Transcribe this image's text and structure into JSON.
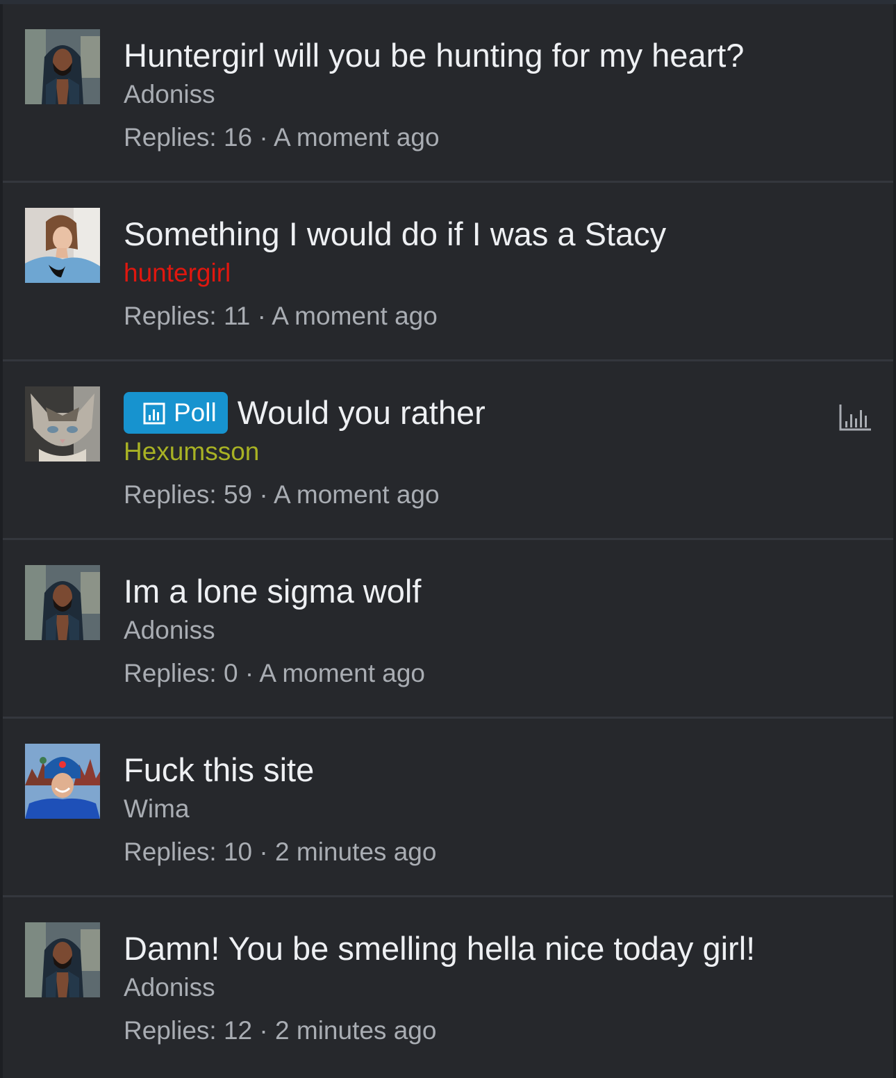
{
  "threads": [
    {
      "title": "Huntergirl will you be hunting for my heart?",
      "author": "Adoniss",
      "replies_label": "Replies:",
      "replies": "16",
      "separator": "·",
      "time": "A moment ago",
      "author_color": "#a9adb3",
      "avatar": "man-hood-avatar"
    },
    {
      "title": "Something I would do if I was a Stacy",
      "author": "huntergirl",
      "replies_label": "Replies:",
      "replies": "11",
      "separator": "·",
      "time": "A moment ago",
      "author_color": "#e0170f",
      "avatar": "woman-avatar"
    },
    {
      "title": "Would you rather",
      "poll_badge": "Poll",
      "author": "Hexumsson",
      "replies_label": "Replies:",
      "replies": "59",
      "separator": "·",
      "time": "A moment ago",
      "author_color": "#a8b224",
      "avatar": "cat-avatar"
    },
    {
      "title": "Im a lone sigma wolf",
      "author": "Adoniss",
      "replies_label": "Replies:",
      "replies": "0",
      "separator": "·",
      "time": "A moment ago",
      "author_color": "#a9adb3",
      "avatar": "man-hood-avatar"
    },
    {
      "title": "Fuck this site",
      "author": "Wima",
      "replies_label": "Replies:",
      "replies": "10",
      "separator": "·",
      "time": "2 minutes ago",
      "author_color": "#a9adb3",
      "avatar": "man-hat-avatar"
    },
    {
      "title": "Damn! You be smelling hella nice today girl!",
      "author": "Adoniss",
      "replies_label": "Replies:",
      "replies": "12",
      "separator": "·",
      "time": "2 minutes ago",
      "author_color": "#a9adb3",
      "avatar": "man-hood-avatar"
    }
  ],
  "colors": {
    "background": "#26282c",
    "title": "#eef0f3",
    "muted": "#a9adb3",
    "poll_badge": "#1793cf"
  },
  "icons": {
    "poll_badge_icon": "bar-chart-icon",
    "poll_indicator_icon": "bar-chart-icon"
  }
}
